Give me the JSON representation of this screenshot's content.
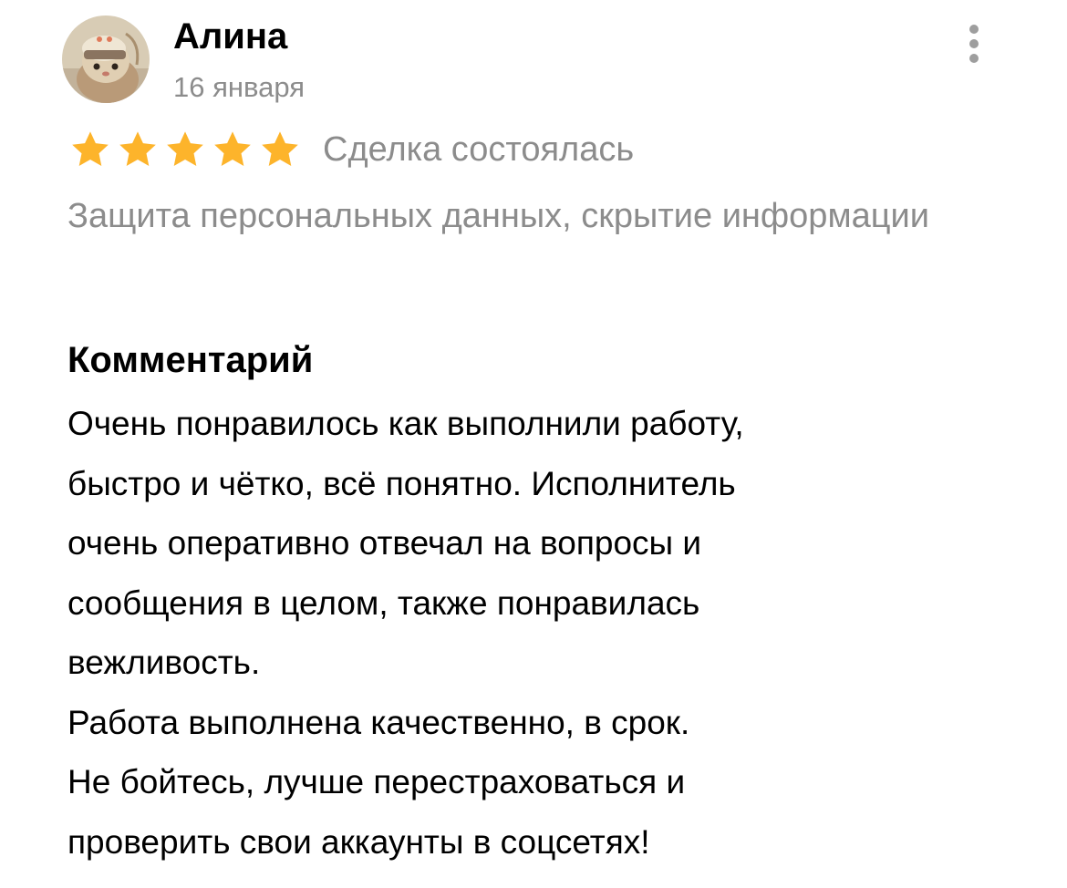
{
  "review": {
    "author": {
      "name": "Алина",
      "avatar_icon": "user-avatar-photo"
    },
    "date": "16 января",
    "menu_icon": "more-vertical-icon",
    "rating": {
      "stars": 5,
      "max_stars": 5,
      "star_color": "#fdb42b",
      "star_icon": "star-icon"
    },
    "deal_status": "Сделка состоялась",
    "service_title": "Защита персональных данных, скрытие информации",
    "comment": {
      "heading": "Комментарий",
      "lines": [
        "Очень понравилось как выполнили работу,",
        "быстро и чётко, всё понятно. Исполнитель",
        "очень оперативно отвечал на вопросы и",
        "сообщения в целом, также понравилась",
        "вежливость.",
        "Работа выполнена качественно, в срок.",
        "Не бойтесь, лучше перестраховаться и",
        "проверить свои аккаунты в соцсетях!"
      ]
    }
  }
}
